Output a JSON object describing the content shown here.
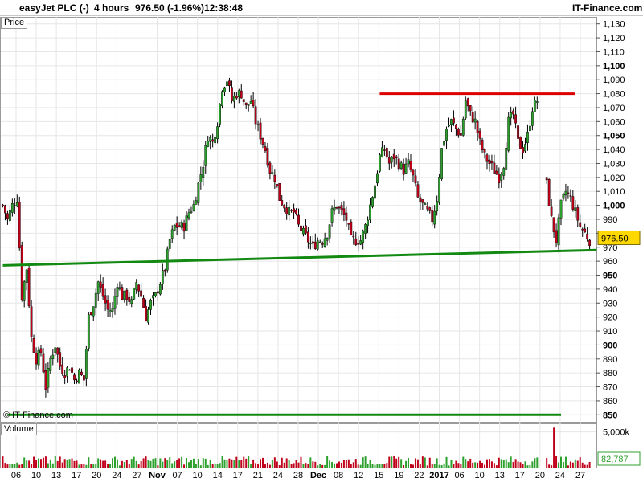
{
  "header": {
    "instrument": "easyJet PLC (-)",
    "timeframe": "4 hours",
    "last_change": "976.50 (-1.96%)",
    "time": "12:38:48",
    "brand": "IT-Finance.com"
  },
  "panes": {
    "price_label": "Price",
    "volume_label": "Volume",
    "watermark": "© IT-Finance.com"
  },
  "price_badge": "976.50",
  "volume_badge": "82,787",
  "chart_data": [
    {
      "type": "candlestick",
      "title": "easyJet PLC (-)",
      "ylim": [
        845,
        1135
      ],
      "y_ticks": [
        850,
        860,
        870,
        880,
        890,
        900,
        910,
        920,
        930,
        940,
        950,
        960,
        970,
        980,
        990,
        1000,
        1010,
        1020,
        1030,
        1040,
        1050,
        1060,
        1070,
        1080,
        1090,
        1100,
        1110,
        1120,
        1130
      ],
      "y_tick_labels": [
        "850",
        "860",
        "870",
        "880",
        "890",
        "900",
        "910",
        "920",
        "930",
        "940",
        "950",
        "960",
        "970",
        "980",
        "990",
        "1,000",
        "1,010",
        "1,020",
        "1,030",
        "1,040",
        "1,050",
        "1,060",
        "1,070",
        "1,080",
        "1,090",
        "1,100",
        "1,110",
        "1,120",
        "1,130"
      ],
      "bold_ticks": [
        850,
        900,
        950,
        1000,
        1050,
        1100
      ],
      "x_tick_labels": [
        "06",
        "10",
        "13",
        "17",
        "20",
        "24",
        "27",
        "Nov",
        "07",
        "10",
        "14",
        "17",
        "21",
        "24",
        "28",
        "Dec",
        "08",
        "12",
        "15",
        "19",
        "22",
        "2017",
        "06",
        "10",
        "13",
        "17",
        "20",
        "24",
        "27"
      ],
      "bold_x_labels": [
        "Nov",
        "Dec",
        "2017"
      ],
      "last_price": 976.5,
      "close_path": [
        [
          0,
          1000
        ],
        [
          2,
          990
        ],
        [
          4,
          1000
        ],
        [
          6,
          1005
        ],
        [
          8,
          935
        ],
        [
          10,
          955
        ],
        [
          12,
          905
        ],
        [
          14,
          890
        ],
        [
          16,
          895
        ],
        [
          18,
          870
        ],
        [
          20,
          890
        ],
        [
          22,
          900
        ],
        [
          24,
          885
        ],
        [
          26,
          880
        ],
        [
          28,
          885
        ],
        [
          30,
          875
        ],
        [
          32,
          880
        ],
        [
          34,
          875
        ],
        [
          36,
          920
        ],
        [
          38,
          930
        ],
        [
          40,
          945
        ],
        [
          42,
          935
        ],
        [
          44,
          925
        ],
        [
          46,
          925
        ],
        [
          48,
          945
        ],
        [
          50,
          935
        ],
        [
          52,
          935
        ],
        [
          54,
          930
        ],
        [
          56,
          945
        ],
        [
          58,
          935
        ],
        [
          60,
          920
        ],
        [
          62,
          930
        ],
        [
          64,
          935
        ],
        [
          66,
          945
        ],
        [
          68,
          955
        ],
        [
          70,
          975
        ],
        [
          72,
          985
        ],
        [
          74,
          985
        ],
        [
          76,
          985
        ],
        [
          78,
          995
        ],
        [
          80,
          1000
        ],
        [
          82,
          1015
        ],
        [
          84,
          1030
        ],
        [
          86,
          1050
        ],
        [
          88,
          1045
        ],
        [
          90,
          1060
        ],
        [
          92,
          1085
        ],
        [
          94,
          1090
        ],
        [
          96,
          1075
        ],
        [
          98,
          1080
        ],
        [
          100,
          1080
        ],
        [
          102,
          1070
        ],
        [
          104,
          1075
        ],
        [
          106,
          1060
        ],
        [
          108,
          1050
        ],
        [
          110,
          1040
        ],
        [
          112,
          1025
        ],
        [
          114,
          1020
        ],
        [
          116,
          1005
        ],
        [
          118,
          1000
        ],
        [
          120,
          995
        ],
        [
          122,
          995
        ],
        [
          124,
          985
        ],
        [
          126,
          980
        ],
        [
          128,
          975
        ],
        [
          130,
          970
        ],
        [
          132,
          975
        ],
        [
          134,
          975
        ],
        [
          136,
          980
        ],
        [
          138,
          995
        ],
        [
          140,
          1000
        ],
        [
          142,
          995
        ],
        [
          144,
          990
        ],
        [
          146,
          975
        ],
        [
          148,
          975
        ],
        [
          150,
          975
        ],
        [
          152,
          985
        ],
        [
          154,
          1000
        ],
        [
          156,
          1015
        ],
        [
          158,
          1035
        ],
        [
          160,
          1040
        ],
        [
          162,
          1030
        ],
        [
          164,
          1035
        ],
        [
          166,
          1030
        ],
        [
          168,
          1025
        ],
        [
          170,
          1030
        ],
        [
          172,
          1020
        ],
        [
          174,
          1005
        ],
        [
          176,
          1000
        ],
        [
          178,
          995
        ],
        [
          180,
          990
        ],
        [
          182,
          1005
        ],
        [
          184,
          1040
        ],
        [
          186,
          1055
        ],
        [
          188,
          1060
        ],
        [
          190,
          1055
        ],
        [
          192,
          1050
        ],
        [
          194,
          1075
        ],
        [
          196,
          1065
        ],
        [
          198,
          1060
        ],
        [
          200,
          1045
        ],
        [
          202,
          1035
        ],
        [
          204,
          1030
        ],
        [
          206,
          1025
        ],
        [
          208,
          1020
        ],
        [
          210,
          1030
        ],
        [
          212,
          1060
        ],
        [
          214,
          1065
        ],
        [
          216,
          1045
        ],
        [
          218,
          1040
        ],
        [
          220,
          1050
        ],
        [
          222,
          1070
        ],
        [
          224,
          1075
        ]
      ],
      "close_path_2": [
        [
          228,
          1015
        ],
        [
          230,
          990
        ],
        [
          232,
          975
        ],
        [
          234,
          1000
        ],
        [
          236,
          1010
        ],
        [
          238,
          1005
        ],
        [
          240,
          995
        ],
        [
          242,
          985
        ],
        [
          244,
          980
        ],
        [
          246,
          975
        ]
      ],
      "volume": {
        "ylim": [
          0,
          6200
        ],
        "y_tick_labels": [
          "5,000k"
        ],
        "y_ticks": [
          5000
        ],
        "spike_index": 231,
        "spike_value": 5600
      },
      "trendlines": [
        {
          "color": "#dd0000",
          "from": [
            158,
            1080
          ],
          "to": [
            240,
            1080
          ]
        },
        {
          "color": "#128a12",
          "from": [
            0,
            957
          ],
          "to": [
            249,
            968
          ]
        },
        {
          "color": "#128a12",
          "from": [
            2,
            850
          ],
          "to": [
            234,
            850
          ]
        }
      ]
    }
  ],
  "colors": {
    "up": "#2ca02c",
    "down": "#c0001a",
    "wick": "#000000",
    "grid": "#e6e6e6",
    "badge": "#ffd800"
  }
}
